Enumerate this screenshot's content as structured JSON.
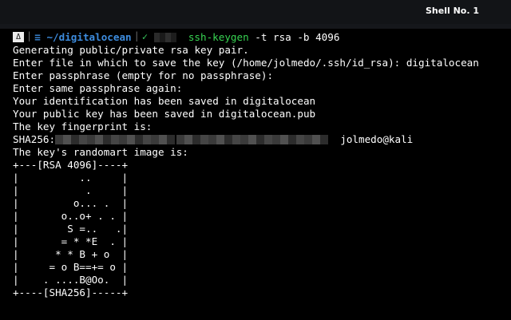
{
  "window": {
    "title": "Shell No. 1"
  },
  "prompt": {
    "os_glyph": "Δ",
    "separator": "|",
    "dir_icon": "≡",
    "directory": "~/digitalocean",
    "status_icon": "✓",
    "command": "ssh-keygen",
    "args": " -t rsa -b 4096"
  },
  "output": {
    "lines": [
      "Generating public/private rsa key pair.",
      "Enter file in which to save the key (/home/jolmedo/.ssh/id_rsa): digitalocean",
      "Enter passphrase (empty for no passphrase):",
      "Enter same passphrase again:",
      "Your identification has been saved in digitalocean",
      "Your public key has been saved in digitalocean.pub",
      "The key fingerprint is:"
    ],
    "fingerprint_prefix": "SHA256:",
    "fingerprint_suffix": "jolmedo@kali",
    "randomart_intro": "The key's randomart image is:",
    "randomart": [
      "+---[RSA 4096]----+",
      "|          ..     |",
      "|           .     |",
      "|         o... .  |",
      "|       o..o+ . . |",
      "|        S =..   .|",
      "|       = * *E  . |",
      "|      * * B + o  |",
      "|     = o B==+= o |",
      "|    . ....B@Oo.  |",
      "+----[SHA256]-----+"
    ]
  },
  "colors": {
    "background": "#000000",
    "text": "#ffffff",
    "command": "#37d452",
    "directory": "#3d8cde"
  }
}
